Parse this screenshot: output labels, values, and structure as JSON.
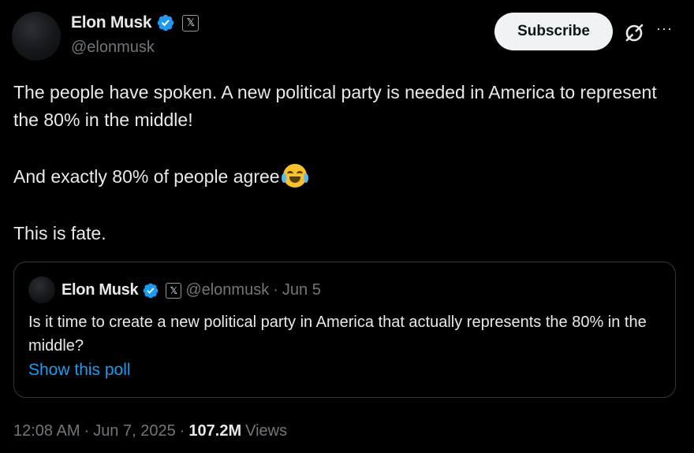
{
  "author": {
    "name": "Elon Musk",
    "handle": "@elonmusk",
    "x_badge": "𝕏"
  },
  "header": {
    "subscribe_label": "Subscribe",
    "more_label": "···"
  },
  "tweet": {
    "line1": "The people have spoken. A new political party is needed in America to represent the 80% in the middle!",
    "line2": "And exactly 80% of people agree",
    "line3": "This is fate.",
    "emoji": "face-with-tears-of-joy"
  },
  "quote": {
    "name": "Elon Musk",
    "handle": "@elonmusk",
    "separator": "·",
    "date": "Jun 5",
    "x_badge": "𝕏",
    "text": "Is it time to create a new political party in America that actually represents the 80% in the middle?",
    "poll_link": "Show this poll"
  },
  "meta": {
    "time": "12:08 AM",
    "separator": "·",
    "date": "Jun 7, 2025",
    "views_count": "107.2M",
    "views_label": "Views"
  },
  "colors": {
    "background": "#000000",
    "text": "#e7e9ea",
    "muted": "#71767b",
    "link": "#1d9bf0",
    "verified": "#1d9bf0"
  }
}
